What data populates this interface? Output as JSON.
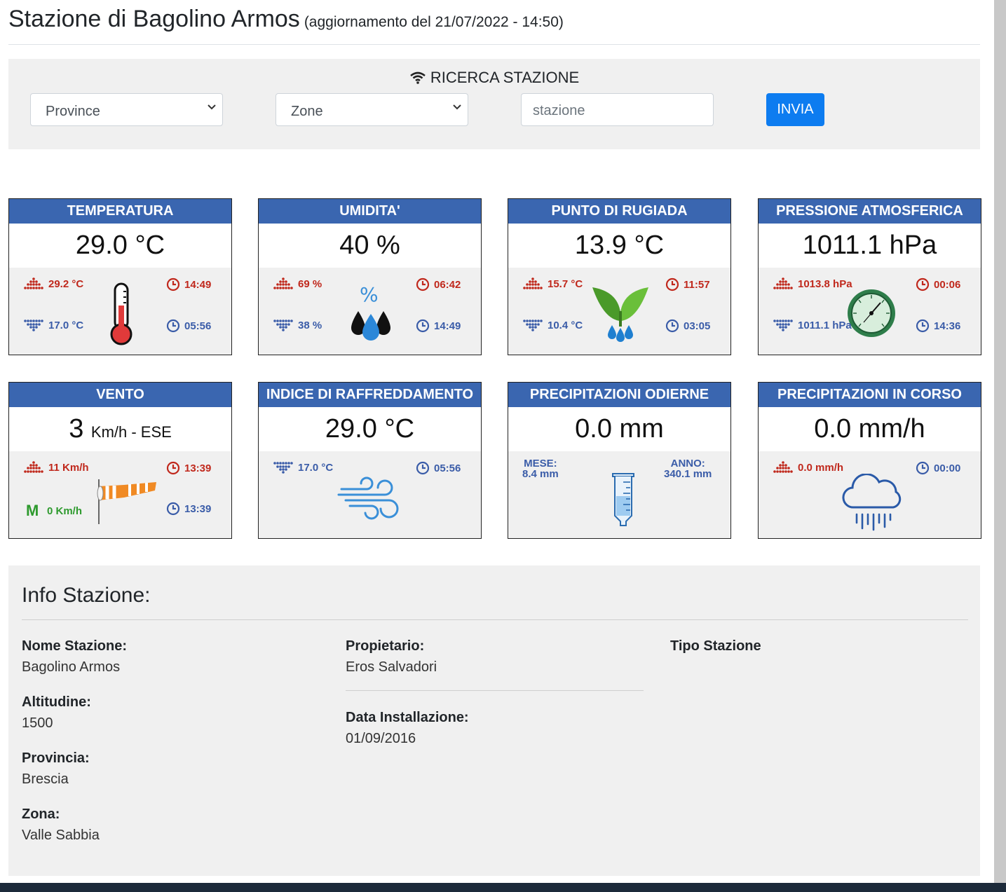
{
  "header": {
    "title": "Stazione di Bagolino Armos",
    "update": "(aggiornamento del 21/07/2022 - 14:50)"
  },
  "search": {
    "title": "RICERCA STAZIONE",
    "province_label": "Province",
    "zone_label": "Zone",
    "station_placeholder": "stazione",
    "submit_label": "INVIA"
  },
  "cards": {
    "temperatura": {
      "title": "TEMPERATURA",
      "value": "29.0 °C",
      "max": "29.2 °C",
      "min": "17.0 °C",
      "max_time": "14:49",
      "min_time": "05:56"
    },
    "umidita": {
      "title": "UMIDITA'",
      "value": "40 %",
      "max": "69 %",
      "min": "38 %",
      "max_time": "06:42",
      "min_time": "14:49"
    },
    "rugiada": {
      "title": "PUNTO DI RUGIADA",
      "value": "13.9 °C",
      "max": "15.7 °C",
      "min": "10.4 °C",
      "max_time": "11:57",
      "min_time": "03:05"
    },
    "pressione": {
      "title": "PRESSIONE ATMOSFERICA",
      "value": "1011.1 hPa",
      "max": "1013.8 hPa",
      "min": "1011.1 hPa",
      "max_time": "00:06",
      "min_time": "14:36"
    },
    "vento": {
      "title": "VENTO",
      "value_num": "3",
      "value_unit": "Km/h - ESE",
      "max": "11 Km/h",
      "mean_badge": "M",
      "mean": "0 Km/h",
      "max_time": "13:39",
      "mean_time": "13:39"
    },
    "raffreddamento": {
      "title": "INDICE DI RAFFREDDAMENTO",
      "value": "29.0 °C",
      "min": "17.0 °C",
      "min_time": "05:56"
    },
    "precip_odierne": {
      "title": "PRECIPITAZIONI ODIERNE",
      "value": "0.0 mm",
      "mese_label": "MESE:",
      "mese_value": "8.4 mm",
      "anno_label": "ANNO:",
      "anno_value": "340.1 mm"
    },
    "precip_corso": {
      "title": "PRECIPITAZIONI IN CORSO",
      "value": "0.0 mm/h",
      "max": "0.0 mm/h",
      "max_time": "00:00"
    }
  },
  "info": {
    "title": "Info Stazione:",
    "nome_label": "Nome Stazione:",
    "nome_value": "Bagolino Armos",
    "altitudine_label": "Altitudine:",
    "altitudine_value": "1500",
    "provincia_label": "Provincia:",
    "provincia_value": "Brescia",
    "zona_label": "Zona:",
    "zona_value": "Valle Sabbia",
    "proprietario_label": "Propietario:",
    "proprietario_value": "Eros Salvadori",
    "installazione_label": "Data Installazione:",
    "installazione_value": "01/09/2016",
    "tipo_label": "Tipo Stazione"
  },
  "colors": {
    "card_header": "#3a66b0",
    "max_red": "#c0281c",
    "min_blue": "#3a5ca8",
    "button_blue": "#0d7cf0",
    "panel_gray": "#f0f0f0"
  }
}
